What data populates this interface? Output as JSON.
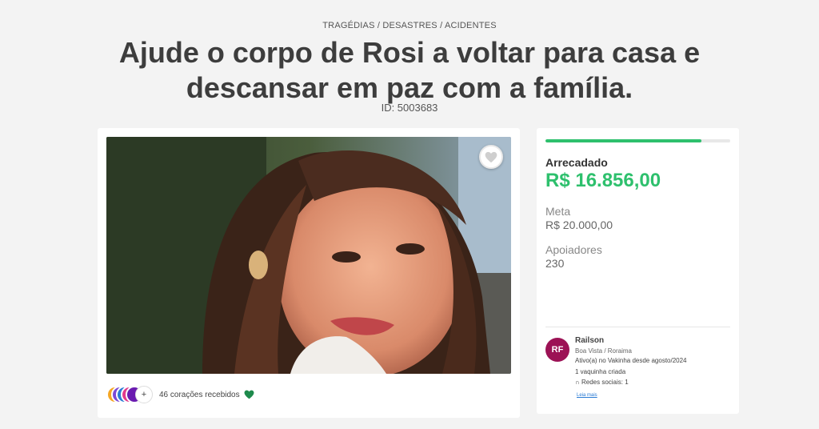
{
  "header": {
    "category": "TRAGÉDIAS / DESASTRES / ACIDENTES",
    "title": "Ajude o corpo de Rosi a voltar para casa e descansar em paz com a família.",
    "id_text": "ID: 5003683"
  },
  "photo_card": {
    "favorite_icon": "heart-outline-icon",
    "hearts_text": "46 corações recebidos",
    "avatar_more": "+",
    "avatar_colors": [
      "#f5a623",
      "#7b4ad6",
      "#2a7bd4",
      "#e23a8c",
      "#6a1bb0"
    ],
    "heart_color": "#1e8a4c"
  },
  "stats": {
    "progress_fraction": 0.843,
    "raised_label": "Arrecadado",
    "raised_value": "R$ 16.856,00",
    "goal_label": "Meta",
    "goal_value": "R$ 20.000,00",
    "supporters_label": "Apoiadores",
    "supporters_value": "230",
    "accent_color": "#2ec06d"
  },
  "organizer": {
    "initials": "RF",
    "name": "Railson",
    "location": "Boa Vista / Roraima",
    "active_since": "Ativo(a) no Vakinha desde agosto/2024",
    "campaigns_created": "1 vaquinha criada",
    "social": "Redes sociais: 1",
    "read_more": "Leia mais",
    "avatar_color": "#9c1255"
  }
}
